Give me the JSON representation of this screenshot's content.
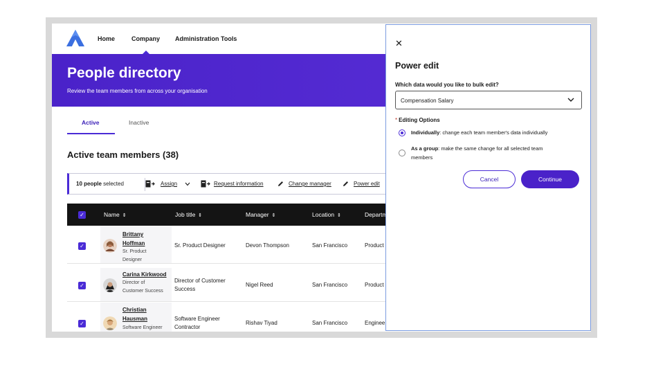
{
  "nav": {
    "items": [
      {
        "label": "Home"
      },
      {
        "label": "Company"
      },
      {
        "label": "Administration Tools"
      }
    ],
    "active": "Company"
  },
  "hero": {
    "title": "People directory",
    "subtitle": "Review the team members from across your organisation"
  },
  "tabs": [
    {
      "label": "Active",
      "active": true
    },
    {
      "label": "Inactive",
      "active": false
    }
  ],
  "section_title": "Active team members (38)",
  "bulk": {
    "count_bold": "10 people",
    "count_rest": " selected",
    "actions": [
      {
        "label": "Assign",
        "icon": "assign-icon"
      },
      {
        "label": "Request information",
        "icon": "request-icon"
      },
      {
        "label": "Change manager",
        "icon": "pencil-icon"
      },
      {
        "label": "Power edit",
        "icon": "pencil-icon"
      }
    ]
  },
  "table": {
    "columns": [
      "Name",
      "Job title",
      "Manager",
      "Location",
      "Departm"
    ],
    "rows": [
      {
        "name_1": "Brittany",
        "name_2": "Hoffman",
        "role_1": "Sr. Product",
        "role_2": "Designer",
        "job_1": "Sr. Product Designer",
        "job_2": "",
        "manager": "Devon Thompson",
        "location": "San Francisco",
        "department": "Product"
      },
      {
        "name_1": "Carina Kirkwood",
        "name_2": "",
        "role_1": "Director of",
        "role_2": "Customer Success",
        "job_1": "Director of Customer",
        "job_2": "Success",
        "manager": "Nigel Reed",
        "location": "San Francisco",
        "department": "Product"
      },
      {
        "name_1": "Christian",
        "name_2": "Hausman",
        "role_1": "Software Engineer",
        "role_2": "",
        "job_1": "Software Engineer",
        "job_2": "Contractor",
        "manager": "Rishav Tiyad",
        "location": "San Francisco",
        "department": "Enginee"
      }
    ]
  },
  "panel": {
    "title": "Power edit",
    "question": "Which data would you like to bulk edit?",
    "selected": "Compensation Salary",
    "options_label": "Editing Options",
    "required_mark": "*",
    "option1_bold": "Individually",
    "option1_rest": ": change each team member's data individually",
    "option2_bold": "As a group",
    "option2_rest_1": ": make the same change for all selected team",
    "option2_rest_2": "members",
    "cancel": "Cancel",
    "continue": "Continue"
  },
  "colors": {
    "brand": "#4a22c9",
    "panel_border": "#7a9be0"
  }
}
